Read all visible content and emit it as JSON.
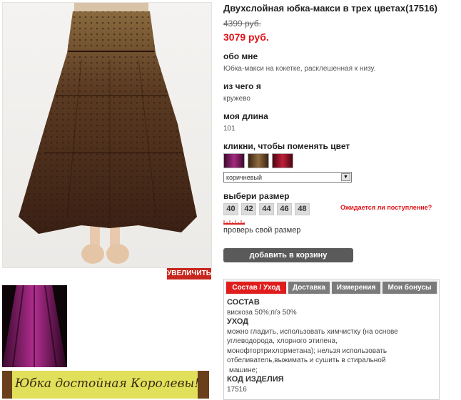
{
  "product": {
    "title": "Двухслойная юбка-макси в трех цветах(17516)",
    "old_price": "4399 руб.",
    "new_price": "3079 руб."
  },
  "gallery": {
    "zoom_label": "УВЕЛИЧИТЬ",
    "banner_text": "Юбка достойная Королевы!"
  },
  "about": {
    "heading": "обо мне",
    "text": "Юбка-макси на кокетке, расклешенная к низу."
  },
  "material": {
    "heading": "из чего я",
    "text": "кружево"
  },
  "length": {
    "heading": "моя длина",
    "text": "101"
  },
  "color": {
    "heading": "кликни, чтобы поменять цвет",
    "swatches": [
      {
        "name": "purple",
        "color": "#7a1f5c"
      },
      {
        "name": "brown",
        "color": "#6a4a2a"
      },
      {
        "name": "red",
        "color": "#a0132a"
      }
    ],
    "selected": "коричневый"
  },
  "size": {
    "heading": "выбери размер",
    "options": [
      "40",
      "42",
      "44",
      "46",
      "48"
    ],
    "expect_link": "Ожидается ли поступление?",
    "check_label": "проверь свой размер"
  },
  "cart": {
    "label": "добавить в корзину"
  },
  "tabs": {
    "items": [
      "Состав / Уход",
      "Доставка",
      "Измерения",
      "Мои бонусы"
    ],
    "content": {
      "composition_heading": "СОСТАВ",
      "composition": "вискоза 50%;п/э 50%",
      "care_heading": "УХОД",
      "care_lines": [
        "можно гладить, использовать химчистку (на основе",
        "углеводорода, хлорного этилена,",
        "монофтортрихлорметана); нельзя использовать",
        "отбеливатель,выжимать и сушить в стиральной",
        "машине;"
      ],
      "code_heading": "КОД ИЗДЕЛИЯ",
      "code": "17516"
    }
  }
}
